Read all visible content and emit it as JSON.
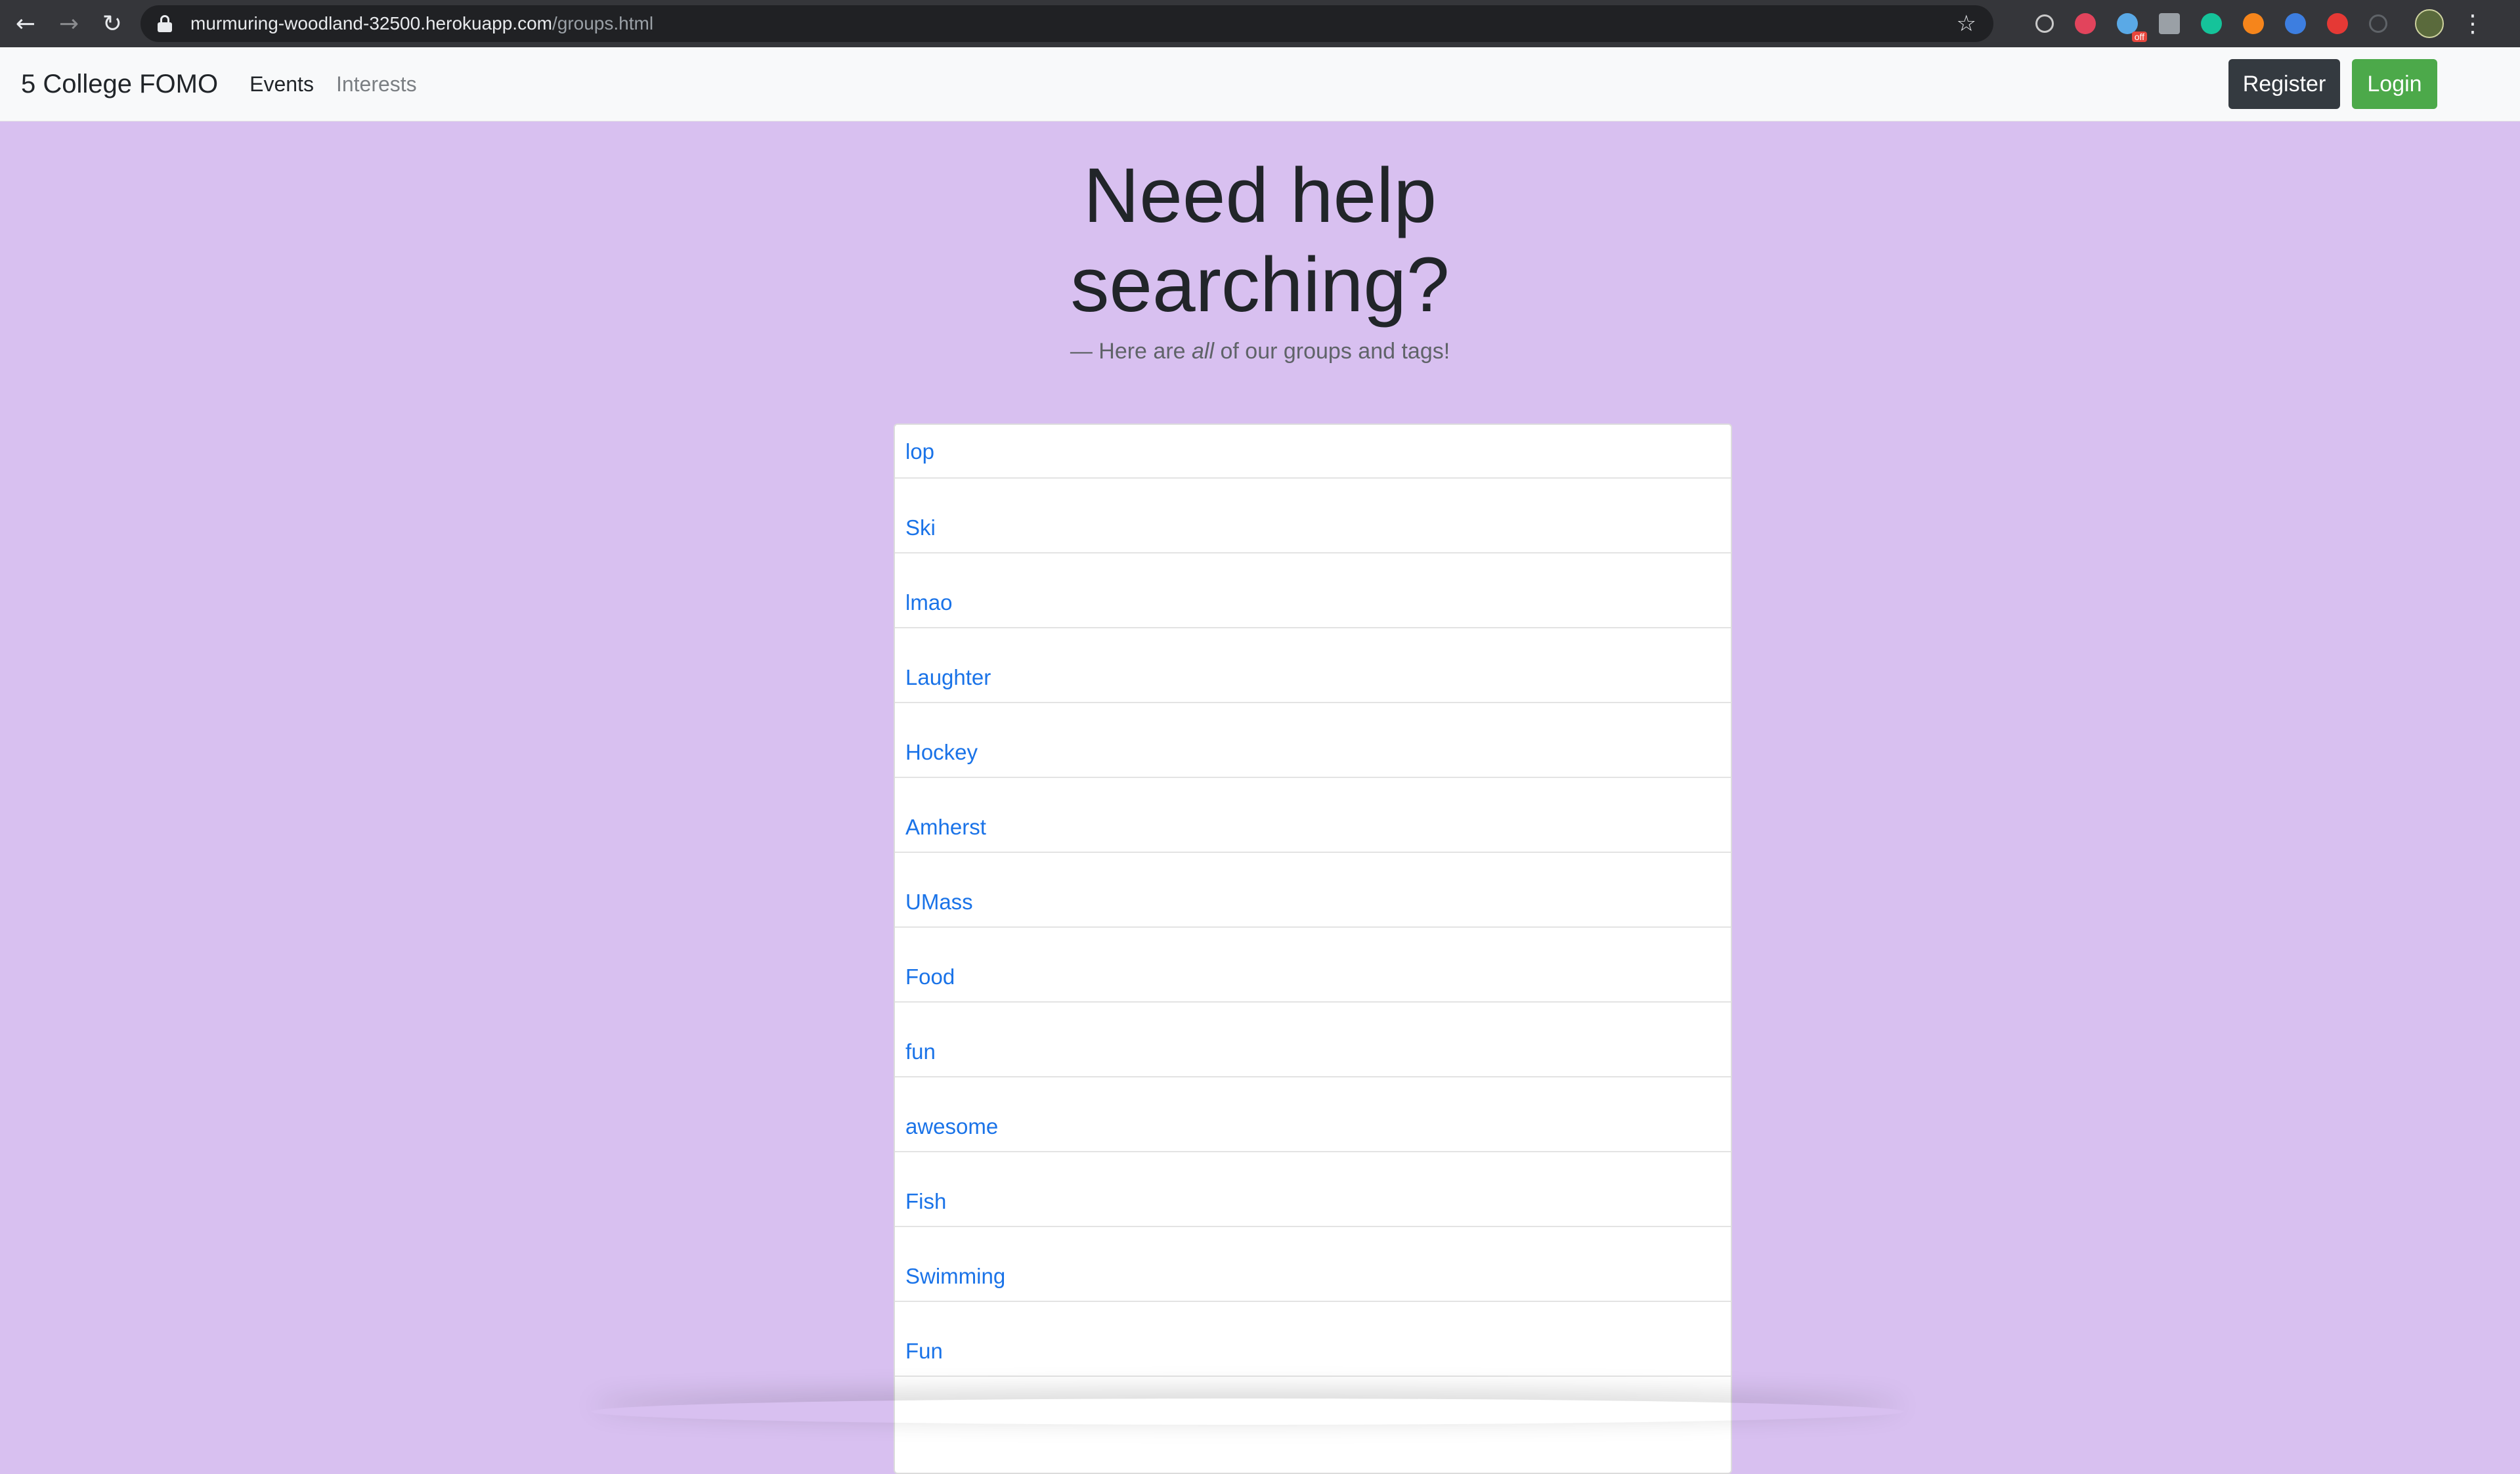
{
  "browser": {
    "url_host": "murmuring-woodland-32500.herokuapp.com",
    "url_path": "/groups.html",
    "extension_badge": "off"
  },
  "navbar": {
    "brand": "5 College FOMO",
    "links": [
      "Events",
      "Interests"
    ],
    "register_label": "Register",
    "login_label": "Login"
  },
  "hero": {
    "title_line1": "Need help",
    "title_line2": "searching?",
    "subtitle_dash": "— Here are ",
    "subtitle_em": "all",
    "subtitle_rest": " of our groups and tags!"
  },
  "groups": [
    "lop",
    "Ski",
    "lmao",
    "Laughter",
    "Hockey",
    "Amherst",
    "UMass",
    "Food",
    "fun",
    "awesome",
    "Fish",
    "Swimming",
    "Fun"
  ],
  "colors": {
    "page_bg": "#d8c0f0",
    "link": "#1a73e8",
    "register_bg": "#343a40",
    "login_bg": "#4ca94a"
  }
}
